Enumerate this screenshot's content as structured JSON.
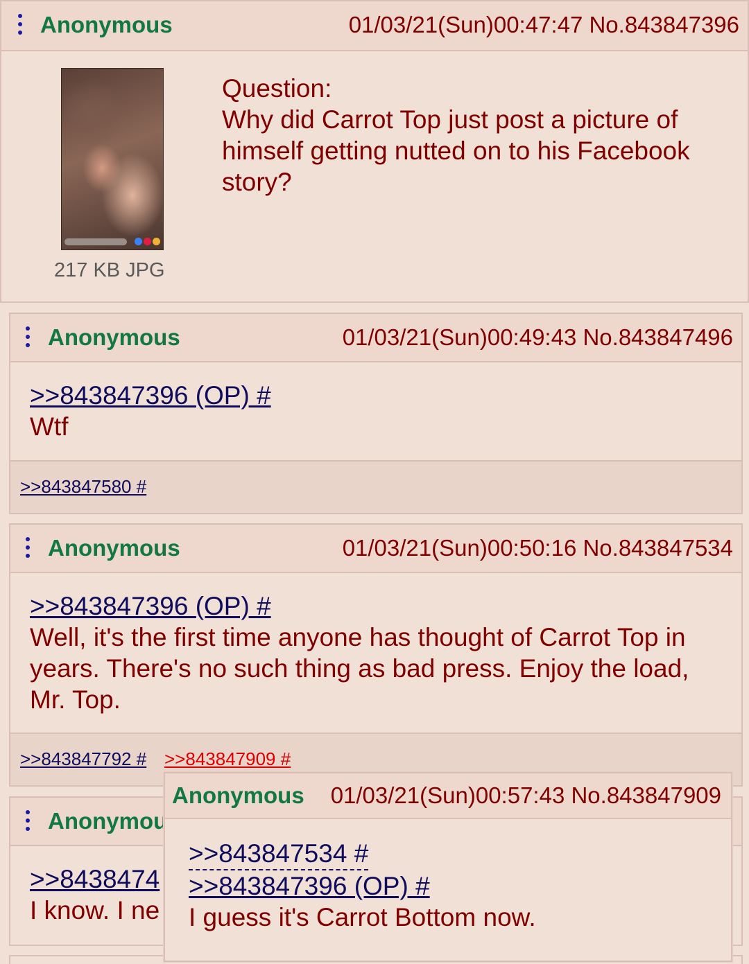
{
  "posts": [
    {
      "name": "Anonymous",
      "date": "01/03/21(Sun)00:47:47",
      "number": "No.843847396",
      "file_info": "217 KB JPG",
      "lines": [
        "Question:",
        "Why did Carrot Top just post a picture of",
        "himself getting nutted on to his Facebook",
        "story?"
      ]
    },
    {
      "name": "Anonymous",
      "date": "01/03/21(Sun)00:49:43",
      "number": "No.843847496",
      "quote": ">>843847396 (OP) #",
      "lines": [
        "Wtf"
      ],
      "backlinks": [
        ">>843847580 #"
      ]
    },
    {
      "name": "Anonymous",
      "date": "01/03/21(Sun)00:50:16",
      "number": "No.843847534",
      "quote": ">>843847396 (OP) #",
      "lines": [
        "Well, it's the first time anyone has thought of Carrot Top in",
        "years. There's no such thing as bad press. Enjoy the load,",
        "Mr. Top."
      ],
      "backlinks": [
        ">>843847792 #",
        ">>843847909 #"
      ]
    },
    {
      "name": "Anonymou",
      "quote": ">>8438474",
      "lines": [
        "I know. I ne"
      ]
    }
  ],
  "popup": {
    "name": "Anonymous",
    "date": "01/03/21(Sun)00:57:43",
    "number": "No.843847909",
    "quote1": ">>843847534 #",
    "quote2": ">>843847396 (OP) #",
    "text": "I guess it's Carrot Bottom now."
  },
  "colors": {
    "background": "#f0e0d6",
    "name_green": "#117743",
    "text_maroon": "#800000",
    "link_blue": "#0f0c5d",
    "highlight_red": "#dd0000"
  }
}
